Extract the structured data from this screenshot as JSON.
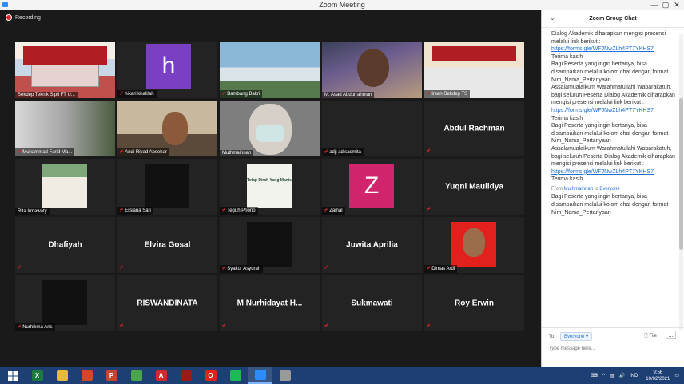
{
  "window": {
    "title": "Zoom Meeting",
    "minimize": "—",
    "maximize": "▢",
    "close": "✕"
  },
  "recording": {
    "label": "Recording"
  },
  "participants": [
    {
      "name": "Sekdep Teknik Sipil FT U...",
      "muted": false,
      "kind": "video",
      "visual": "v1",
      "active": true
    },
    {
      "name": "hikari khalilah",
      "muted": true,
      "kind": "video",
      "visual": "vh",
      "letter": "h"
    },
    {
      "name": "Bambang Bakri",
      "muted": true,
      "kind": "video",
      "visual": "v3"
    },
    {
      "name": "M. Asad Abdurrahman",
      "muted": false,
      "kind": "video",
      "visual": "v4"
    },
    {
      "name": "Irsan-Sekdep TS",
      "muted": true,
      "kind": "video",
      "visual": "v5"
    },
    {
      "name": "Muhammad Farid Ma...",
      "muted": true,
      "kind": "video",
      "visual": "v6"
    },
    {
      "name": "Andi Riyad Absehar",
      "muted": true,
      "kind": "video",
      "visual": "v7"
    },
    {
      "name": "Muthmainnah",
      "muted": false,
      "kind": "video",
      "visual": "v8"
    },
    {
      "name": "adji adisasmita",
      "muted": true,
      "kind": "blank"
    },
    {
      "name": "Abdul Rachman",
      "muted": true,
      "kind": "nameonly"
    },
    {
      "name": "Rita Irmawaty",
      "muted": false,
      "kind": "video",
      "visual": "vrita"
    },
    {
      "name": "Ersiana Sari",
      "muted": true,
      "kind": "video",
      "visual": "vdark"
    },
    {
      "name": "Teguh Priono",
      "muted": true,
      "kind": "video",
      "visual": "vposter",
      "poster_text": "Tetap Dirah Yang Manis"
    },
    {
      "name": "Zainal",
      "muted": true,
      "kind": "video",
      "visual": "vz",
      "letter": "Z"
    },
    {
      "name": "Yuqni Maulidya",
      "muted": true,
      "kind": "nameonly"
    },
    {
      "name": "Dhafiyah",
      "muted": true,
      "kind": "nameonly"
    },
    {
      "name": "Elvira Gosal",
      "muted": true,
      "kind": "nameonly"
    },
    {
      "name": "Syakur Asyurah",
      "muted": true,
      "kind": "video",
      "visual": "vdark"
    },
    {
      "name": "Juwita Aprilia",
      "muted": true,
      "kind": "nameonly"
    },
    {
      "name": "Dimas Ardi",
      "muted": true,
      "kind": "video",
      "visual": "vdimas"
    },
    {
      "name": "Nurhikma Aris",
      "muted": true,
      "kind": "video",
      "visual": "vdark"
    },
    {
      "name": "RISWANDINATA",
      "muted": true,
      "kind": "nameonly"
    },
    {
      "name": "M Nurhidayat H...",
      "muted": true,
      "kind": "nameonly"
    },
    {
      "name": "Sukmawati",
      "muted": true,
      "kind": "nameonly"
    },
    {
      "name": "Roy Erwin",
      "muted": true,
      "kind": "nameonly"
    }
  ],
  "chat": {
    "title": "Zoom Group Chat",
    "messages": [
      {
        "t": "text",
        "v": "Dialog Akademik diharapkan mengisi presensi melalui link berikut :"
      },
      {
        "t": "link",
        "v": "https://forms.gle/WFJNwZLh4PT7YKHS7"
      },
      {
        "t": "text",
        "v": "Terima kasih"
      },
      {
        "t": "text",
        "v": "Bagi Peserta yang ingin bertanya, bisa disampaikan melalui kolom chat dengan format"
      },
      {
        "t": "text",
        "v": "Nim_Nama_Pertanyaan"
      },
      {
        "t": "text",
        "v": "Assalamualaikum Warahmatullahi Wabarakatuh, bagi seluruh Peserta Dialog Akademik diharapkan mengisi presensi melalui link berikut :"
      },
      {
        "t": "link",
        "v": "https://forms.gle/WFJNwZLh4PT7YKHS7"
      },
      {
        "t": "text",
        "v": "Terima kasih"
      },
      {
        "t": "text",
        "v": "Bagi Peserta yang ingin bertanya, bisa disampaikan melalui kolom chat dengan format"
      },
      {
        "t": "text",
        "v": "Nim_Nama_Pertanyaan"
      },
      {
        "t": "text",
        "v": "Assalamualaikum Warahmatullahi Wabarakatuh, bagi seluruh Peserta Dialog Akademik diharapkan mengisi presensi melalui link berikut :"
      },
      {
        "t": "link",
        "v": "https://forms.gle/WFJNwZLh4PT7YKHS7"
      },
      {
        "t": "text",
        "v": "Terima kasih"
      },
      {
        "t": "from",
        "sender": "Muthmainnah",
        "to": "Everyone"
      },
      {
        "t": "text",
        "v": "Bagi Peserta yang ingin bertanya, bisa disampaikan melalui kolom chat dengan format"
      },
      {
        "t": "text",
        "v": "Nim_Nama_Pertanyaan"
      }
    ],
    "from_word": "From",
    "to_word": "to",
    "to_label": "To:",
    "recipient": "Everyone",
    "file_label": "File",
    "more_label": "...",
    "input_placeholder": "Type message here..."
  },
  "taskbar": {
    "apps": [
      {
        "name": "excel",
        "letter": "X",
        "color": "#1d7a3e"
      },
      {
        "name": "file-explorer",
        "letter": "",
        "color": "#e8b93a"
      },
      {
        "name": "media",
        "letter": "",
        "color": "#d24726"
      },
      {
        "name": "powerpoint",
        "letter": "P",
        "color": "#c4472c"
      },
      {
        "name": "chrome",
        "letter": "",
        "color": "#4aa54a"
      },
      {
        "name": "acrobat",
        "letter": "A",
        "color": "#d22a2a"
      },
      {
        "name": "app-red",
        "letter": "",
        "color": "#9a1a1a"
      },
      {
        "name": "opera",
        "letter": "O",
        "color": "#e0231b"
      },
      {
        "name": "spotify",
        "letter": "",
        "color": "#1db954"
      },
      {
        "name": "zoom",
        "letter": "",
        "color": "#2d8cff"
      },
      {
        "name": "app-gray",
        "letter": "",
        "color": "#9a9a9a"
      }
    ],
    "lang": "IND",
    "time": "9:56",
    "date": "10/02/2021"
  }
}
